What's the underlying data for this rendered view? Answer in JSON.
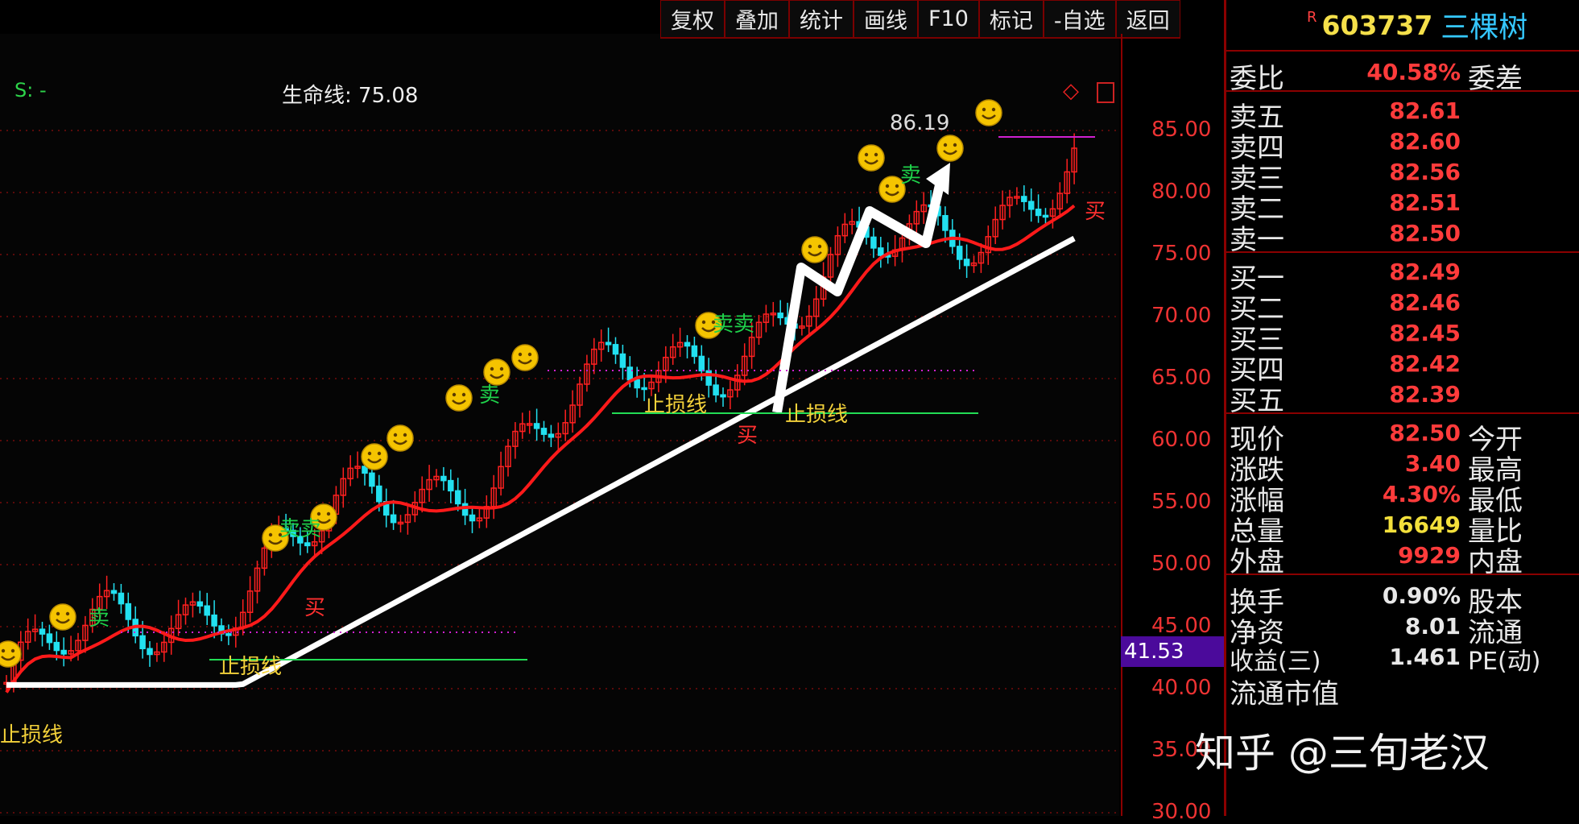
{
  "toolbar": [
    "复权",
    "叠加",
    "统计",
    "画线",
    "F10",
    "标记",
    "-自选",
    "返回"
  ],
  "stock": {
    "badge": "R",
    "code": "603737",
    "name": "三棵树"
  },
  "chart": {
    "s_label": "S: -",
    "life_label": "生命线: 75.08",
    "peak_label": "86.19",
    "current_marker": "41.53",
    "stop_label": "止损线",
    "buy_label": "买",
    "sell_label": "卖",
    "sell_label2": "卖卖",
    "ticks": [
      "85.00",
      "80.00",
      "75.00",
      "70.00",
      "65.00",
      "60.00",
      "55.00",
      "50.00",
      "45.00",
      "40.00",
      "35.00",
      "30.00"
    ]
  },
  "panel": {
    "weibi": {
      "label": "委比",
      "value": "40.58%",
      "label2": "委差"
    },
    "asks": [
      {
        "label": "卖五",
        "value": "82.61"
      },
      {
        "label": "卖四",
        "value": "82.60"
      },
      {
        "label": "卖三",
        "value": "82.56"
      },
      {
        "label": "卖二",
        "value": "82.51"
      },
      {
        "label": "卖一",
        "value": "82.50"
      }
    ],
    "bids": [
      {
        "label": "买一",
        "value": "82.49"
      },
      {
        "label": "买二",
        "value": "82.46"
      },
      {
        "label": "买三",
        "value": "82.45"
      },
      {
        "label": "买四",
        "value": "82.42"
      },
      {
        "label": "买五",
        "value": "82.39"
      }
    ],
    "quote": [
      {
        "label": "现价",
        "value": "82.50",
        "label2": "今开"
      },
      {
        "label": "涨跌",
        "value": "3.40",
        "label2": "最高"
      },
      {
        "label": "涨幅",
        "value": "4.30%",
        "label2": "最低"
      },
      {
        "label": "总量",
        "value": "16649",
        "label2": "量比"
      },
      {
        "label": "外盘",
        "value": "9929",
        "label2": "内盘"
      }
    ],
    "extra": [
      {
        "label": "换手",
        "value": "0.90%",
        "label2": "股本"
      },
      {
        "label": "净资",
        "value": "8.01",
        "label2": "流通"
      },
      {
        "label": "收益(三)",
        "value": "1.461",
        "label2": "PE(动)"
      },
      {
        "label": "流通市值",
        "value": "",
        "label2": ""
      }
    ]
  },
  "watermark": "知乎 @三旬老汉",
  "colors": {
    "up": "#ff2020",
    "down": "#22e0f0",
    "ma": "#ff1a1a",
    "lifeline": "#ffffff",
    "stopline": "#22dd55"
  }
}
